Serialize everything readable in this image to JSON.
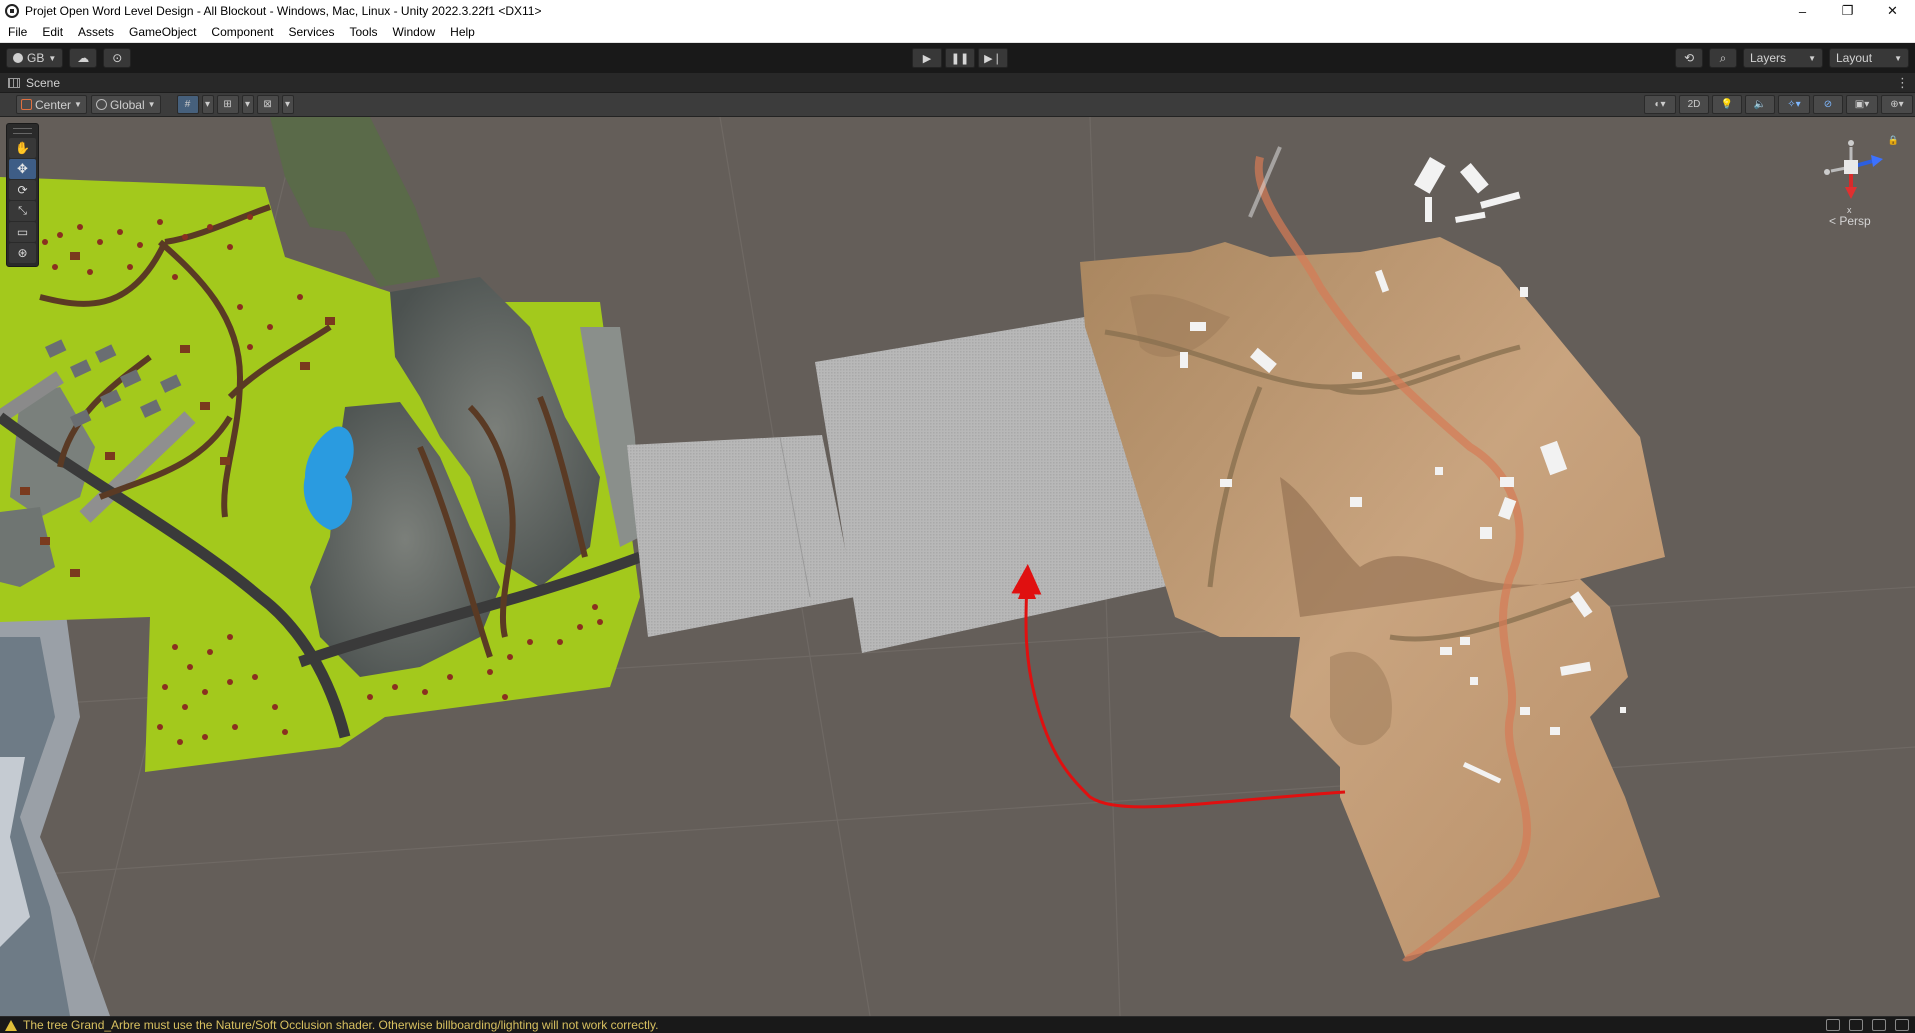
{
  "window": {
    "title": "Projet Open Word Level Design - All Blockout - Windows, Mac, Linux - Unity 2022.3.22f1 <DX11>",
    "minimize": "–",
    "restore": "❐",
    "close": "✕"
  },
  "menu": [
    "File",
    "Edit",
    "Assets",
    "GameObject",
    "Component",
    "Services",
    "Tools",
    "Window",
    "Help"
  ],
  "toolbar": {
    "account_label": "GB",
    "layers_label": "Layers",
    "layout_label": "Layout"
  },
  "scene_tab": {
    "label": "Scene"
  },
  "scene_toolbar": {
    "pivot_label": "Center",
    "space_label": "Global",
    "mode_2d_label": "2D"
  },
  "gizmo": {
    "projection_label": "< Persp"
  },
  "status": {
    "message": "The tree Grand_Arbre must use the Nature/Soft Occlusion shader. Otherwise billboarding/lighting will not work correctly."
  },
  "colors": {
    "viewport_ground": "#645e59",
    "green_terrain": "#a3c91c",
    "desert_terrain": "#c29c77",
    "annotation_arrow": "#e01010",
    "water": "#2a9be0",
    "blockout_plane": "#b5b5b5"
  }
}
